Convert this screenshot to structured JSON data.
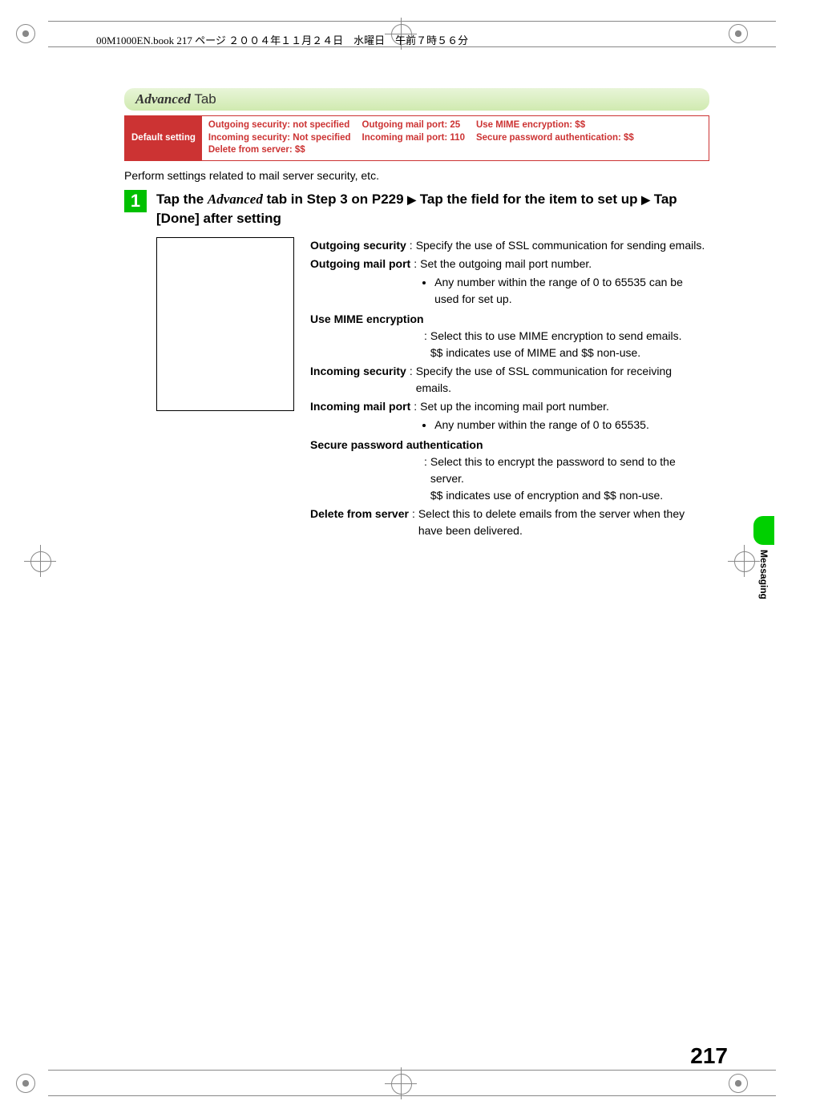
{
  "header_runline": "00M1000EN.book  217 ページ  ２００４年１１月２４日　水曜日　午前７時５６分",
  "tab": {
    "title_italic": "Advanced",
    "title_plain": " Tab"
  },
  "default_setting": {
    "label": "Default setting",
    "col1": [
      "Outgoing security: not specified",
      "Incoming security: Not specified",
      "Delete from server: $$"
    ],
    "col2": [
      "Outgoing mail port: 25",
      "Incoming mail port: 110"
    ],
    "col3": [
      "Use MIME encryption: $$",
      "Secure password authentication: $$"
    ]
  },
  "intro": "Perform settings related to mail server security, etc.",
  "step": {
    "number": "1",
    "text_a": "Tap the ",
    "text_italic": "Advanced",
    "text_b": " tab in Step 3 on P229 ",
    "arrow1": "▶",
    "text_c": " Tap the field for the item to set up ",
    "arrow2": "▶",
    "text_d": " Tap [Done] after setting"
  },
  "definitions": {
    "outgoing_security": {
      "term": "Outgoing security",
      "desc": "Specify the use of SSL communication for sending emails."
    },
    "outgoing_mail_port": {
      "term": "Outgoing mail port",
      "desc": "Set the outgoing mail port number.",
      "bullet": "Any number within the range of 0 to 65535 can be used for set up."
    },
    "use_mime": {
      "term": "Use MIME encryption",
      "desc": "Select this to use MIME encryption to send emails.",
      "note": "$$ indicates use of MIME and $$ non-use."
    },
    "incoming_security": {
      "term": "Incoming security",
      "desc": "Specify the use of SSL communication for receiving emails."
    },
    "incoming_mail_port": {
      "term": "Incoming mail port",
      "desc": "Set up the incoming mail port number.",
      "bullet": "Any number within the range of 0 to 65535."
    },
    "secure_password": {
      "term": "Secure password authentication",
      "desc": "Select this to encrypt the password to send to the server.",
      "note": "$$ indicates use of encryption and $$ non-use."
    },
    "delete_from_server": {
      "term": "Delete from server",
      "desc": "Select this to delete emails from the server when they have been delivered."
    }
  },
  "side_label": "Messaging",
  "page_number": "217"
}
